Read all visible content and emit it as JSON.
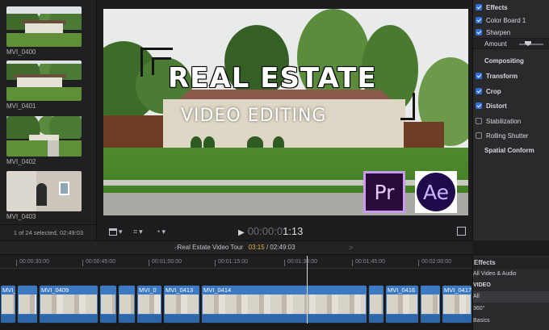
{
  "browser": {
    "clips": [
      {
        "name": "MVI_0400"
      },
      {
        "name": "MVI_0401"
      },
      {
        "name": "MVI_0402"
      },
      {
        "name": "MVI_0403"
      }
    ],
    "selection_info": "1 of 24 selected, 02:49:03"
  },
  "viewer": {
    "title_main": "REAL ESTATE",
    "title_sub": "VIDEO EDITING",
    "logo_pr": "Pr",
    "logo_ae": "Ae",
    "timecode_dim": "00:00:0",
    "timecode": "1:13"
  },
  "inspector": {
    "rows": [
      {
        "label": "Effects",
        "checked": true,
        "kind": "section"
      },
      {
        "label": "Color Board 1",
        "checked": true,
        "kind": "item"
      },
      {
        "label": "Sharpen",
        "checked": true,
        "kind": "item"
      },
      {
        "label": "Amount",
        "kind": "param"
      },
      {
        "label": "Compositing",
        "kind": "plain"
      },
      {
        "label": "Transform",
        "checked": true,
        "kind": "section"
      },
      {
        "label": "Crop",
        "checked": true,
        "kind": "section"
      },
      {
        "label": "Distort",
        "checked": true,
        "kind": "section"
      },
      {
        "label": "Stabilization",
        "checked": false,
        "kind": "item"
      },
      {
        "label": "Rolling Shutter",
        "checked": false,
        "kind": "item"
      },
      {
        "label": "Spatial Conform",
        "kind": "plain"
      }
    ]
  },
  "timeline": {
    "project_name": "Real Estate Video Tour",
    "position": "03:15",
    "separator": "/",
    "duration": "02:49:03",
    "ruler": [
      "00:00:30:00",
      "00:00:45:00",
      "00:01:00:00",
      "00:01:15:00",
      "00:01:30:00",
      "00:01:45:00",
      "00:02:00:00"
    ],
    "clips": [
      "MVI_",
      "MVI_0409",
      "",
      "",
      "MVI_0",
      "MVI_0413",
      "MVI_0414",
      "",
      "MVI_0416",
      "",
      "MVI_0417"
    ]
  },
  "effects_browser": {
    "title": "Effects",
    "rows": [
      "All Video & Audio",
      "VIDEO",
      "All",
      "360°",
      "Basics"
    ]
  }
}
